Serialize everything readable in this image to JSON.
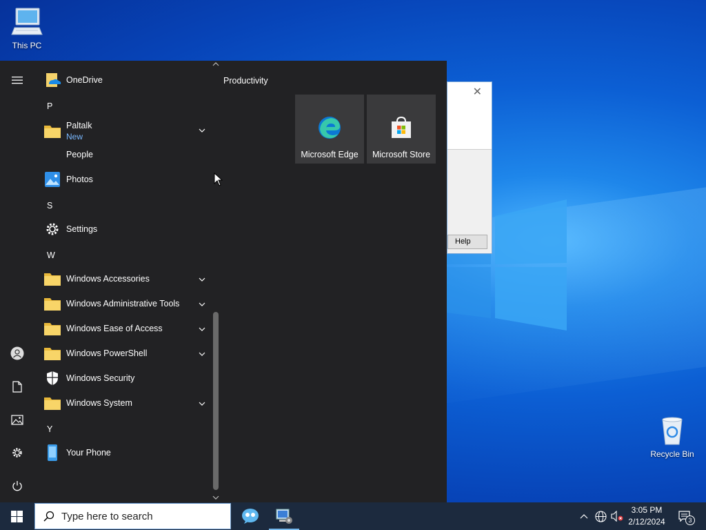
{
  "desktop": {
    "icons": [
      {
        "label": "This PC"
      },
      {
        "label": "Recycle Bin"
      }
    ]
  },
  "dialog": {
    "help_label": "Help"
  },
  "start_menu": {
    "apps": [
      {
        "letter": null,
        "name": "OneDrive",
        "icon": "onedrive-icon"
      },
      {
        "letter": "P"
      },
      {
        "name": "Paltalk",
        "sub": "New",
        "icon": "folder-icon",
        "expandable": true
      },
      {
        "name": "People",
        "icon": "people-icon"
      },
      {
        "name": "Photos",
        "icon": "photos-icon"
      },
      {
        "letter": "S"
      },
      {
        "name": "Settings",
        "icon": "gear-icon"
      },
      {
        "letter": "W"
      },
      {
        "name": "Windows Accessories",
        "icon": "folder-icon",
        "expandable": true
      },
      {
        "name": "Windows Administrative Tools",
        "icon": "folder-icon",
        "expandable": true
      },
      {
        "name": "Windows Ease of Access",
        "icon": "folder-icon",
        "expandable": true
      },
      {
        "name": "Windows PowerShell",
        "icon": "folder-icon",
        "expandable": true
      },
      {
        "name": "Windows Security",
        "icon": "shield-icon"
      },
      {
        "name": "Windows System",
        "icon": "folder-icon",
        "expandable": true
      },
      {
        "letter": "Y"
      },
      {
        "name": "Your Phone",
        "icon": "phone-icon"
      }
    ],
    "group_title": "Productivity",
    "tiles": [
      {
        "name": "Microsoft Edge",
        "icon": "edge-icon"
      },
      {
        "name": "Microsoft Store",
        "icon": "store-icon"
      }
    ]
  },
  "taskbar": {
    "search_placeholder": "Type here to search",
    "time": "3:05 PM",
    "date": "2/12/2024",
    "notification_count": "3"
  },
  "colors": {
    "accent": "#0078d7",
    "start_bg": "#222224",
    "tile_bg": "#3a3a3c",
    "sub_label": "#7ab8ff"
  }
}
